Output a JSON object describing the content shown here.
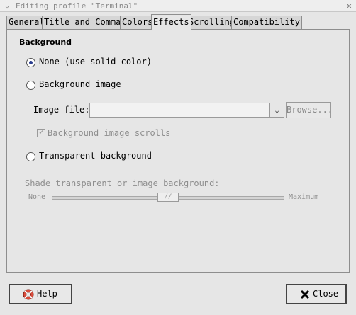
{
  "window": {
    "title": "Editing profile \"Terminal\""
  },
  "tabs": [
    {
      "label": "General"
    },
    {
      "label": "Title and Command"
    },
    {
      "label": "Colors"
    },
    {
      "label": "Effects",
      "active": true
    },
    {
      "label": "Scrolling"
    },
    {
      "label": "Compatibility"
    }
  ],
  "background": {
    "section_title": "Background",
    "option_none": "None (use solid color)",
    "option_image": "Background image",
    "image_file_label": "Image file:",
    "image_file_value": "",
    "browse_label": "Browse...",
    "scrolls_label": "Background image scrolls",
    "scrolls_checked": true,
    "option_transparent": "Transparent background",
    "selected": "none",
    "shade_label": "Shade transparent or image background:",
    "shade_min_label": "None",
    "shade_max_label": "Maximum",
    "shade_level": 0.5
  },
  "buttons": {
    "help_label": "Help",
    "close_label": "Close"
  },
  "icons": {
    "help": "lifebuoy-icon",
    "close": "x-icon"
  }
}
